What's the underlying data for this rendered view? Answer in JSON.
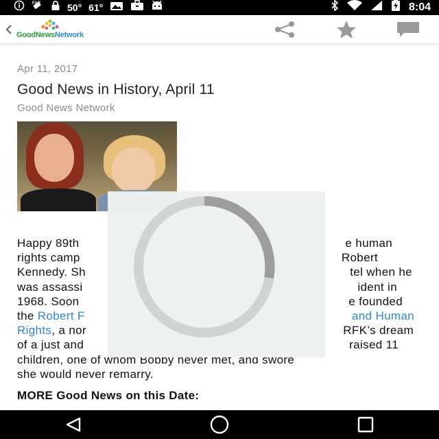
{
  "status_bar": {
    "temp1": "50°",
    "temp2": "61°",
    "time": "8:04"
  },
  "toolbar": {
    "logo_text_a": "GoodNews",
    "logo_text_b": "Network",
    "icons": [
      "back-arrow",
      "share",
      "star",
      "comment"
    ]
  },
  "article": {
    "date": "Apr 11, 2017",
    "title": "Good News in History, April 11",
    "source": "Good News Network",
    "paragraph": {
      "line1_a": "Happy 89th",
      "line1_b": "e human",
      "line2_a": "rights camp",
      "line2_b": "Robert",
      "line3_a": "Kennedy. Sh",
      "line3_b": "tel when he",
      "line4_a": "was assassi",
      "line4_b": "ident in",
      "line5_a": "1968. Soon",
      "line5_b": "e founded",
      "line6_a": "the ",
      "line6_link_a": "Robert F",
      "line6_link_b": "and Human",
      "line7_link": "Rights",
      "line7_a": ", a nor",
      "line7_b": "RFK’s dream",
      "line8_a": "of a just and",
      "line8_b": "raised 11",
      "line9": "children, one of whom Bobby never met, and swore",
      "line10": "she would never remarry."
    },
    "more_heading": "MORE Good News on this Date:"
  },
  "colors": {
    "link": "#2e86d6",
    "muted_text": "#8c8c8c",
    "overlay": "#ecf1f0",
    "spinner_track": "#d0d3d3",
    "spinner_arc": "#9c9e9e"
  }
}
